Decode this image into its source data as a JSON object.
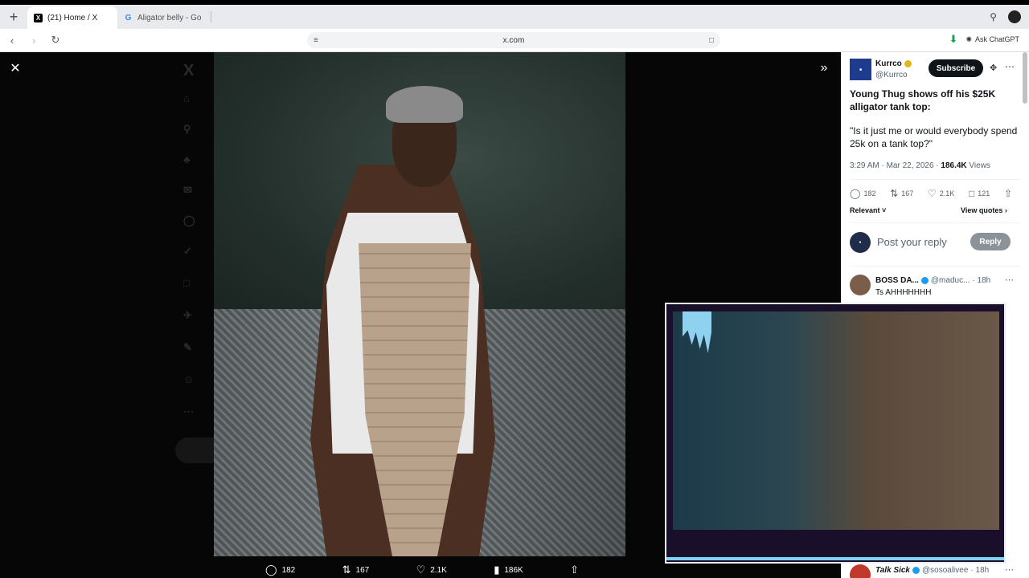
{
  "browser": {
    "new_tab": "+",
    "tabs": [
      {
        "label": "(21) Home / X",
        "active": true,
        "favicon": "x-logo-icon"
      },
      {
        "label": "Aligator belly - Goog",
        "active": false,
        "favicon": "google-logo-icon"
      }
    ],
    "url": "x.com",
    "ask_chatgpt": "Ask ChatGPT"
  },
  "photo_actions": {
    "replies": "182",
    "reposts": "167",
    "likes": "2.1K",
    "views": "186K"
  },
  "post": {
    "author_name": "Kurrco",
    "author_handle": "@Kurrco",
    "subscribe": "Subscribe",
    "headline": "Young Thug shows off his $25K alligator tank top:",
    "quote": "\"Is it just me or would everybody spend 25k on a tank top?\"",
    "timestamp": "3:29 AM · Mar 22, 2026 · ",
    "views_count": "186.4K",
    "views_label": " Views",
    "replies": "182",
    "reposts": "167",
    "likes": "2.1K",
    "bookmarks": "121",
    "relevant": "Relevant",
    "view_quotes": "View quotes"
  },
  "reply_box": {
    "placeholder": "Post your reply",
    "button": "Reply"
  },
  "comments": [
    {
      "name": "BOSS DA...",
      "handle": "@maduc...",
      "time": "· 18h",
      "body": "Ts AHHHHHHH"
    },
    {
      "name": "Talk Sick",
      "handle": "@sosoalivee",
      "time": "· 18h",
      "body": ""
    }
  ],
  "icons": {
    "close": "close-icon",
    "expand": "double-chevron-right-icon",
    "reply": "reply-icon",
    "repost": "repost-icon",
    "like": "heart-icon",
    "views": "views-icon",
    "bookmark": "bookmark-icon",
    "share": "share-icon"
  },
  "colors": {
    "subscribe_bg": "#0f1419",
    "reply_btn_bg": "#8b9298",
    "verified_gold": "#e2b719",
    "verified_blue": "#1d9bf0",
    "download_green": "#1aa34a"
  }
}
